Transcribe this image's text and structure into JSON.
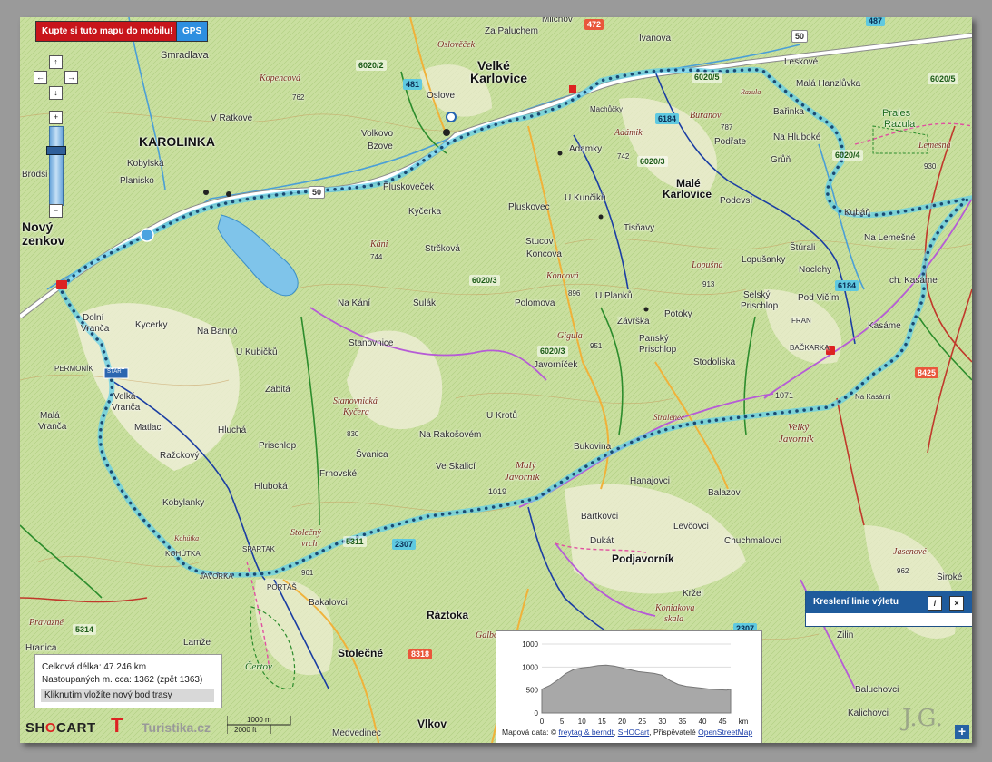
{
  "top_buttons": {
    "buy_label": "Kupte si tuto mapu do mobilu!",
    "gps_label": "GPS"
  },
  "nav": {
    "up": "↑",
    "left": "←",
    "right": "→",
    "down": "↓",
    "zoom_in": "+",
    "zoom_out": "−"
  },
  "towns": {
    "karolinka": "KAROLINKA",
    "velke1": "Velké",
    "velke2": "Karlovice",
    "male1": "Malé",
    "male2": "Karlovice",
    "novy1": "Nový",
    "novy2": "zenkov",
    "stolecne": "Stolečné",
    "raztoka": "Ráztoka",
    "podjavornik": "Podjavorník",
    "vlkov": "Vlkov"
  },
  "places": {
    "smradlava": "Smradlava",
    "ratkove": "V Ratkové",
    "kobylska": "Kobylská",
    "planisko": "Planisko",
    "brodsi": "Brodsi",
    "volkovo": "Volkovo",
    "bzove": "Bzove",
    "oslove": "Oslove",
    "oslovecek": "Oslověček",
    "zapaluchem": "Za Paluchem",
    "mlichov": "Mlichov",
    "ivanova": "Ivanova",
    "leskove": "Leskové",
    "mala_hanzlukva": "Malá Hanzlůvka",
    "barinka": "Bařinka",
    "podrate": "Podřate",
    "na_hluboke": "Na Hluboké",
    "grun": "Grůň",
    "prales1": "Prales",
    "prales2": "Razula",
    "adamky": "Adamky",
    "machacky": "Machůčky",
    "pluskovecek": "Pluskoveček",
    "kycerka": "Kyčerka",
    "pluskovec": "Pluskovec",
    "u_kunciku": "U Kunčiků",
    "podevsi": "Podevsí",
    "tisnavy": "Tisňavy",
    "kuban": "Kubáň",
    "na_lemesne": "Na Lemešné",
    "sturali": "Štúrali",
    "lopusanky": "Lopušanky",
    "noclehy": "Noclehy",
    "strckova": "Strčková",
    "stucov": "Stucov",
    "koncova": "Koncova",
    "polomova": "Polomova",
    "u_planku": "U Planků",
    "selsky1": "Selský",
    "selsky2": "Prischlop",
    "pod_vicim": "Pod Vičím",
    "ch_kasame": "ch. Kasáme",
    "kasame": "Kasáme",
    "na_kani": "Na Kání",
    "sulak": "Šulák",
    "potoky": "Potoky",
    "zavrska": "Závrška",
    "pansky1": "Panský",
    "pansky2": "Prischlop",
    "fran": "FRAN",
    "backarka": "BAČKARKA",
    "stodoliska": "Stodoliska",
    "dolni1": "Dolní",
    "dolni2": "Vranča",
    "kycerky": "Kycerky",
    "na_banno": "Na Bannó",
    "u_kubicku": "U Kubičků",
    "stanovnice": "Stanovnice",
    "javornicek": "Javorníček",
    "permonik": "PERMONÍK",
    "velka1": "Velká",
    "velka2": "Vranča",
    "zabita": "Zabitá",
    "matlaci": "Matlaci",
    "mala1": "Malá",
    "mala2": "Vranča",
    "hluchá": "Hluchá",
    "u_krotu": "U Krotů",
    "na_rakosovem": "Na Rakošovém",
    "bukovina": "Bukovina",
    "svanica": "Švanica",
    "razckovy": "Ražckový",
    "prischlop": "Prischlop",
    "ve_skalici": "Ve Skalicí",
    "frnovske": "Frnovské",
    "hluboka": "Hluboká",
    "kobylanky": "Kobylanky",
    "kohutka": "KOHÚTKA",
    "spartak": "SPARTAK",
    "javorka": "JAVORKA",
    "portas": "PORTÁŠ",
    "bakalovci": "Bakalovci",
    "hanajovci": "Hanajovci",
    "balazov": "Balazov",
    "bartkovci": "Bartkovci",
    "levcovci": "Levčovci",
    "chuchmalovci": "Chuchmalovci",
    "dukat": "Dukát",
    "krzel": "Kržel",
    "lamze": "Lamže",
    "hranica": "Hranica",
    "zilin": "Žilin",
    "siroke": "Široké",
    "baluchovci": "Baluchovci",
    "kalichovci": "Kalichovci",
    "medvedinec": "Medvedinec",
    "mala_vranca_full": "Malá Vranča",
    "na_kasarni": "Na Kasárni",
    "stralenec": "Stralenec",
    "start": "START"
  },
  "peaks": {
    "kopencova": "Kopencová",
    "kani": "Káni",
    "koncova_p": "Koncová",
    "adamik": "Adámik",
    "lopusna": "Lopušná",
    "lemesna": "Lemešná",
    "gigula": "Gigula",
    "stanovnicka1": "Stanovnická",
    "stanovnicka2": "Kyčera",
    "maly1": "Malý",
    "maly2": "Javorník",
    "velky1": "Velký",
    "velky2": "Javorník",
    "stolecny1": "Stolečný",
    "stolecny2": "vrch",
    "kohutka_p": "Kohútka",
    "certov": "Čertov",
    "jasenove": "Jasenové",
    "koniakova1": "Koniakova",
    "koniakova2": "skala",
    "galbova": "Galbova",
    "buranov": "Buranov",
    "razula": "Razula",
    "pravazne": "Pravazné"
  },
  "elevations": {
    "e1019": "1019",
    "e1071": "1071",
    "e896": "896",
    "e951": "951",
    "e913": "913",
    "e930": "930",
    "e830": "830",
    "e744": "744",
    "e762": "762",
    "e742": "742",
    "e961": "961",
    "e962": "962",
    "e787": "787"
  },
  "road_numbers": {
    "r472": "472",
    "r487": "487",
    "r481": "481",
    "r50a": "50",
    "r50b": "50",
    "r8425": "8425",
    "r8318": "8318",
    "r6184a": "6184",
    "r6184b": "6184",
    "r2307a": "2307",
    "r2307b": "2307",
    "r5311": "5311",
    "r5314": "5314",
    "t6020_2": "6020/2",
    "t6020_3a": "6020/3",
    "t6020_3b": "6020/3",
    "t6020_3c": "6020/3",
    "t6020_4": "6020/4",
    "t6020_5": "6020/5",
    "t6020_x": "6020/5"
  },
  "info": {
    "length": "Celková délka: 47.246 km",
    "ascent": "Nastoupaných m. cca: 1362 (zpět 1363)",
    "hint": "Kliknutím vložíte nový bod trasy"
  },
  "scale": {
    "m": "1000 m",
    "ft": "2000 ft"
  },
  "logos": {
    "shocart_a": "SH",
    "shocart_o": "O",
    "shocart_b": "CART",
    "t": "T",
    "turistika": "Turistika.cz",
    "jg": "J.G."
  },
  "profile": {
    "y_ticks": [
      "1000",
      "1000",
      "500",
      "0"
    ],
    "x_ticks": [
      "0",
      "5",
      "10",
      "15",
      "20",
      "25",
      "30",
      "35",
      "40",
      "45"
    ],
    "x_unit": "km",
    "credit_prefix": "Mapová data: ©",
    "credit_link1": "freytag & berndt",
    "credit_mid": ",",
    "credit_link2": "SHOCart",
    "credit_mid2": ", Přispěvatelé",
    "credit_link3": "OpenStreetMap"
  },
  "chart_data": {
    "type": "area",
    "title": "",
    "xlabel": "km",
    "ylabel": "",
    "xlim": [
      0,
      47
    ],
    "ylim": [
      0,
      1500
    ],
    "x": [
      0,
      2,
      4,
      6,
      8,
      10,
      12,
      14,
      16,
      18,
      20,
      22,
      24,
      26,
      28,
      30,
      32,
      34,
      36,
      38,
      40,
      42,
      44,
      46,
      47
    ],
    "series": [
      {
        "values": [
          520,
          600,
          720,
          860,
          950,
          980,
          1000,
          1030,
          1040,
          1020,
          980,
          940,
          900,
          880,
          860,
          820,
          700,
          620,
          580,
          560,
          540,
          520,
          510,
          500,
          520
        ]
      }
    ]
  },
  "drawpanel": {
    "title": "Kreslení linie výletu",
    "edit": "/",
    "close": "×"
  },
  "plus": "+"
}
